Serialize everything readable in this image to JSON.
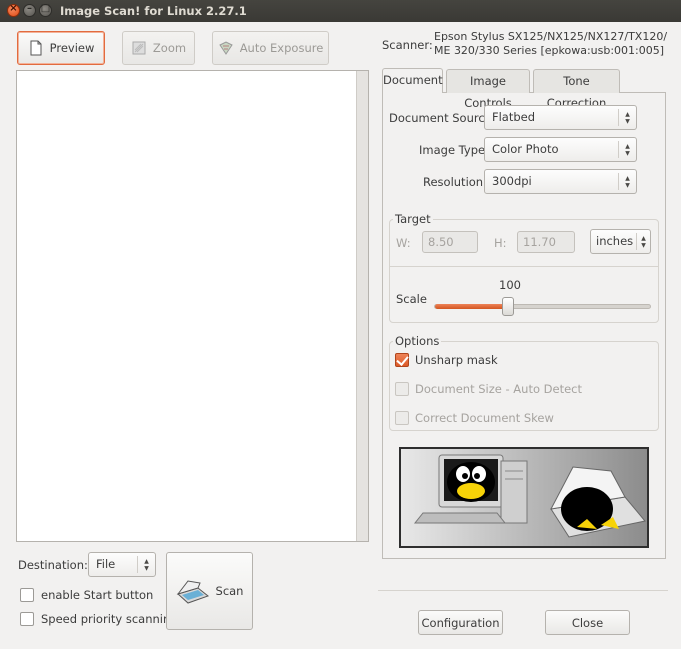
{
  "window": {
    "title": "Image Scan! for Linux 2.27.1",
    "close_glyph": "×",
    "min_glyph": "–",
    "max_glyph": "□"
  },
  "toolbar": {
    "preview_label": "Preview",
    "zoom_label": "Zoom",
    "auto_exposure_label": "Auto Exposure"
  },
  "scanner": {
    "label": "Scanner:",
    "name_line1": "Epson Stylus SX125/NX125/NX127/TX120/",
    "name_line2": "ME 320/330 Series [epkowa:usb:001:005]"
  },
  "tabs": [
    {
      "label": "Document",
      "active": true
    },
    {
      "label": "Image Controls",
      "active": false
    },
    {
      "label": "Tone Correction",
      "active": false
    }
  ],
  "document": {
    "source_label": "Document Source:",
    "source_value": "Flatbed",
    "image_type_label": "Image Type:",
    "image_type_value": "Color Photo",
    "resolution_label": "Resolution:",
    "resolution_value": "300dpi"
  },
  "target": {
    "title": "Target",
    "w_label": "W:",
    "w_value": "8.50",
    "h_label": "H:",
    "h_value": "11.70",
    "units_value": "inches",
    "scale_label": "Scale",
    "scale_value": "100",
    "scale_fraction": 0.33
  },
  "options": {
    "title": "Options",
    "items": [
      {
        "label": "Unsharp mask",
        "checked": true,
        "enabled": true
      },
      {
        "label": "Document Size - Auto Detect",
        "checked": false,
        "enabled": false
      },
      {
        "label": "Correct Document Skew",
        "checked": false,
        "enabled": false
      }
    ]
  },
  "bottom": {
    "destination_label": "Destination:",
    "destination_value": "File",
    "enable_start_label": "enable Start button",
    "speed_priority_label": "Speed priority scanning",
    "scan_label": "Scan",
    "configuration_label": "Configuration",
    "close_label": "Close"
  },
  "colors": {
    "accent": "#df5a28",
    "titlebar": "#3c3b37"
  }
}
